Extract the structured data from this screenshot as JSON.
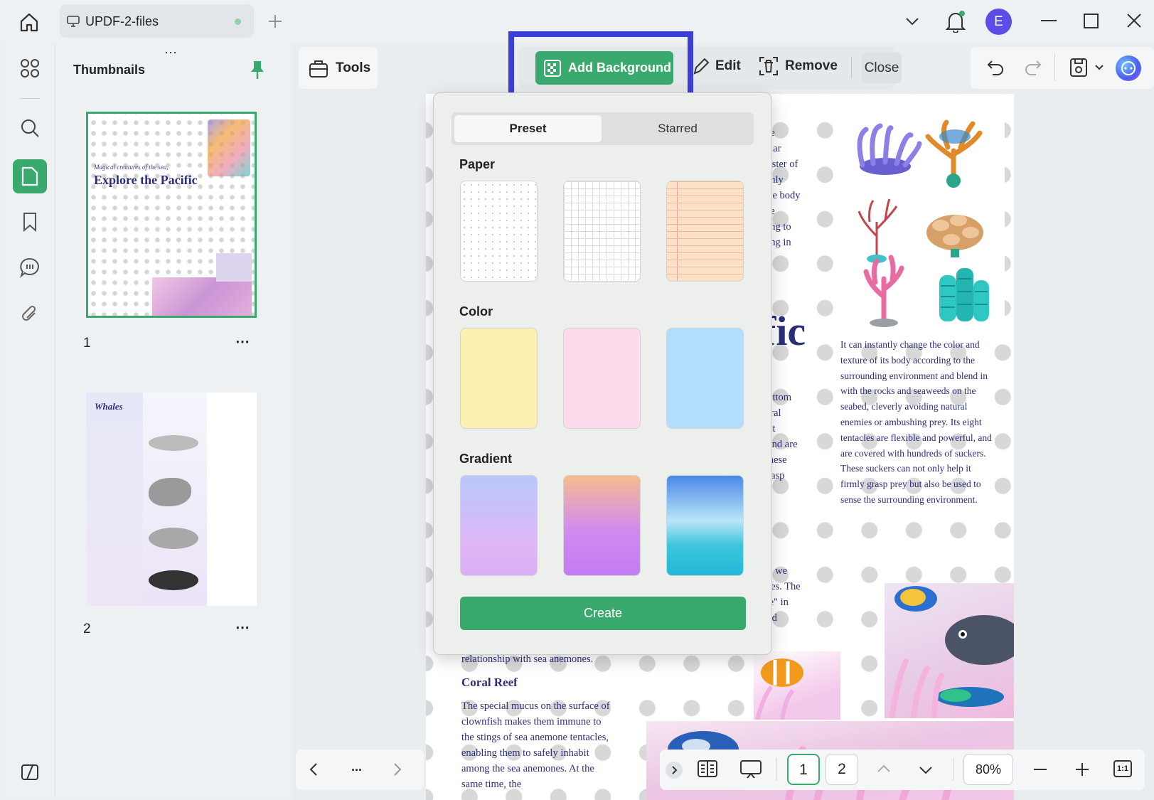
{
  "window": {
    "tab_label": "UPDF-2-files",
    "user_initial": "E"
  },
  "sidebar": {
    "title": "Thumbnails",
    "pages": [
      {
        "number": "1",
        "heading": "Explore the Pacific",
        "subheading": "Magical creatures of the sea,"
      },
      {
        "number": "2",
        "heading": "Whales"
      }
    ]
  },
  "toolbar": {
    "tools_label": "Tools",
    "add_background_label": "Add Background",
    "edit_label": "Edit",
    "remove_label": "Remove",
    "close_label": "Close"
  },
  "background_popup": {
    "tabs": [
      "Preset",
      "Starred"
    ],
    "active_tab": "Preset",
    "sections": {
      "paper": "Paper",
      "color": "Color",
      "gradient": "Gradient"
    },
    "colors": [
      "#fdf0b3",
      "#fcdcec",
      "#b3ddfd"
    ],
    "create_label": "Create"
  },
  "document": {
    "title_fragment": "fic",
    "right_paragraph": "It can instantly change the color and texture of its body according to the surrounding environment and blend in with the rocks and seaweeds on the seabed, cleverly avoiding natural enemies or ambushing prey. Its eight tentacles are flexible and powerful, and are covered with hundreds of suckers. These suckers can not only help it firmly grasp prey but also be used to sense the surrounding environment.",
    "top_fragments": [
      "the",
      "uliar",
      "naster of",
      "ighly",
      "que body",
      "the",
      "ding to",
      "ding in"
    ],
    "mid_fragments": [
      "bottom",
      "tural",
      "ght",
      ", and are",
      "These",
      "grasp"
    ],
    "lower_fragments": [
      "nd we",
      "ures. The",
      "ise\" in",
      "ped"
    ],
    "symbiosis_text": "formed a wonderful symbiotic relationship with sea anemones.",
    "coral_reef_heading": "Coral Reef",
    "coral_reef_text": " The special mucus on the surface of clownfish makes them immune to the stings of sea anemone tentacles, enabling them to safely inhabit among the sea anemones. At the same time, the"
  },
  "navigation": {
    "pages": [
      "1",
      "2"
    ],
    "current_page": "1",
    "zoom": "80%",
    "fit_label": "1:1",
    "more_label": "..."
  },
  "accent_color": "#3aa96e",
  "highlight_color": "#3b3fd8"
}
